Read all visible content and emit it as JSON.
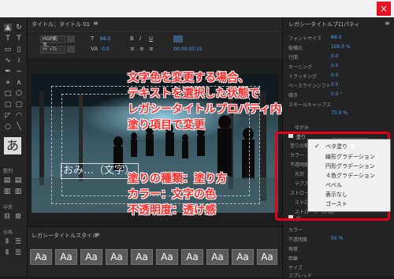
{
  "window": {
    "close_glyph": "×"
  },
  "center_panel": {
    "tab_title": "タイトル：タイトル 01",
    "menu_glyph": "≡",
    "font_family": "HGP創英...",
    "font_style": "ﾒﾃﾞｨｱﾑ",
    "font_size_value": "88.0",
    "kerning_value": "0.0",
    "timecode": "00;00;03;15"
  },
  "canvas_caption": "おみ…（文字）",
  "annotation": {
    "line1": "文字色を変更する場合、",
    "line2": "テキストを選択した状態で",
    "line3": "レガシータイトルプロパティ内の",
    "line4": "塗り項目で変更",
    "detail1": "塗りの種類：塗り方",
    "detail2": "カラー：文字の色",
    "detail3": "不透明度：透け感"
  },
  "right_panel": {
    "title": "レガシータイトルプロパティ",
    "properties": [
      {
        "label": "フォントサイズ",
        "value": "88.0"
      },
      {
        "label": "縦横比",
        "value": "100.0 %"
      },
      {
        "label": "行間",
        "value": "0.0"
      },
      {
        "label": "カーニング",
        "value": "0.0"
      },
      {
        "label": "トラッキング",
        "value": "0.0"
      },
      {
        "label": "ベースラインシフト",
        "value": "0.0"
      },
      {
        "label": "傾き",
        "value": "0.0 °"
      },
      {
        "label": "スモールキャップス",
        "value": ""
      },
      {
        "label": "",
        "value": "75.0 %"
      }
    ],
    "section_distort": "ゆがみ",
    "fill": {
      "section": "塗り",
      "type_label": "塗りの種類",
      "color_label": "カラー",
      "opacity_label": "不透明度",
      "gloss_label": "光沢",
      "texture_label": "テクスチャ",
      "stroke_section": "ストローク",
      "stroke_inner": "ストローク（内側）",
      "stroke_outer": "ストローク（外側）",
      "shadow_section": "影",
      "current_type": "ベタ塗り"
    },
    "below_labels": [
      "カラー",
      "不透明度",
      "角度",
      "距離",
      "サイズ",
      "スプレッド"
    ],
    "below_values": [
      "",
      "50 %",
      "",
      "",
      "",
      ""
    ]
  },
  "fill_type_menu": {
    "items": [
      "ベタ塗り",
      "線形グラデーション",
      "円形グラデーション",
      "４色グラデーション",
      "ベベル",
      "表示なし",
      "ゴースト"
    ],
    "selected_index": 0
  },
  "styles_panel": {
    "title": "レガシータイトルスタイル",
    "menu_glyph": "≡",
    "swatches": [
      "Aa",
      "Aa",
      "Aa",
      "Aa",
      "Aa",
      "Aa",
      "Aa",
      "Aa",
      "Aa",
      "Aa"
    ]
  },
  "left_sidebar": {
    "labels": [
      "整列",
      "中央",
      "分布"
    ],
    "text_glyph": "あ"
  },
  "colors": {
    "accent_blue": "#4ea3ff",
    "annotation_red": "#ff2a2a",
    "highlight_red": "#e8001a"
  }
}
